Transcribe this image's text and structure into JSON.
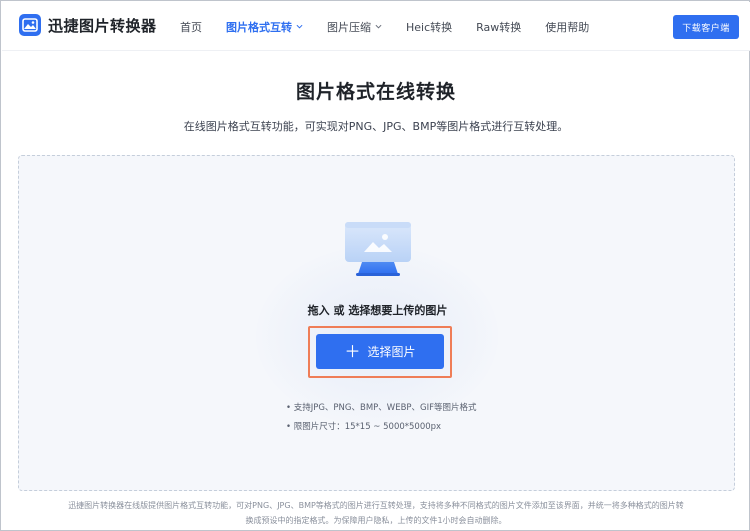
{
  "app": {
    "name": "迅捷图片转换器"
  },
  "nav": {
    "items": [
      {
        "label": "首页",
        "active": false,
        "dropdown": false
      },
      {
        "label": "图片格式互转",
        "active": true,
        "dropdown": true
      },
      {
        "label": "图片压缩",
        "active": false,
        "dropdown": true
      },
      {
        "label": "Heic转换",
        "active": false,
        "dropdown": false
      },
      {
        "label": "Raw转换",
        "active": false,
        "dropdown": false
      },
      {
        "label": "使用帮助",
        "active": false,
        "dropdown": false
      }
    ],
    "download_label": "下载客户端"
  },
  "hero": {
    "title": "图片格式在线转换",
    "subtitle": "在线图片格式互转功能，可实现对PNG、JPG、BMP等图片格式进行互转处理。"
  },
  "upload": {
    "hint": "拖入 或 选择想要上传的图片",
    "button_label": "选择图片",
    "button_icon": "plus-icon",
    "support": [
      "• 支持JPG、PNG、BMP、WEBP、GIF等图片格式",
      "• 限图片尺寸：15*15 ~ 5000*5000px"
    ]
  },
  "footer": {
    "lines": [
      "迅捷图片转换器在线版提供图片格式互转功能，可对PNG、JPG、BMP等格式的图片进行互转处理，支持将多种不同格式的图片文件添加至该界面，并统一将多种格式的图片转",
      "换成预设中的指定格式。为保障用户隐私，上传的文件1小时会自动删除。"
    ]
  },
  "colors": {
    "accent": "#2f6ff0",
    "highlight_border": "#ef7d57"
  }
}
